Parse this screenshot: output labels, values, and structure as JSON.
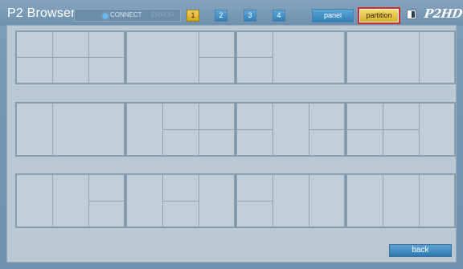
{
  "header": {
    "title": "P2 Browser",
    "connect_label": "CONNECT",
    "status_label": "ERROR",
    "number_buttons": [
      "1",
      "2",
      "3",
      "4"
    ],
    "active_number": "1",
    "panel_label": "panel",
    "partition_label": "partition",
    "logo_text": "P2HD"
  },
  "footer": {
    "back_label": "back"
  },
  "colors": {
    "accent_blue": "#2f7fb7",
    "active_yellow": "#d3a61c",
    "highlight_red": "#d62b2b"
  }
}
